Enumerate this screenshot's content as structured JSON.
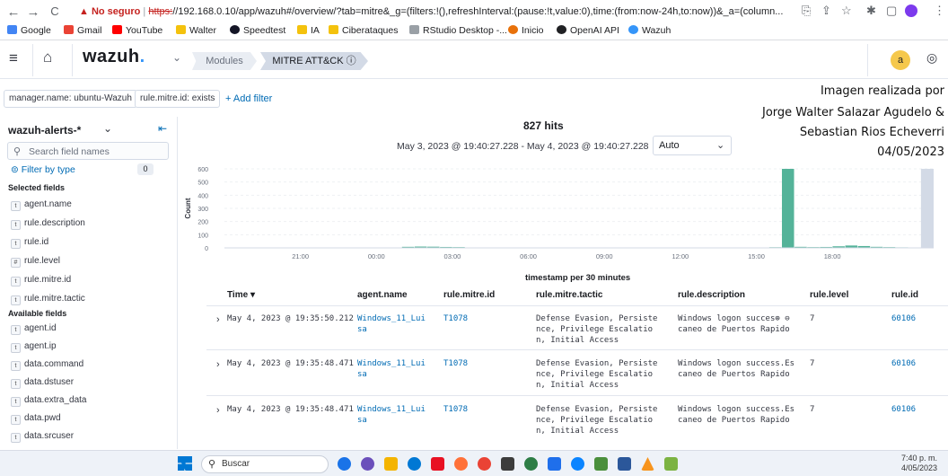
{
  "browser": {
    "nav": {
      "back": "←",
      "forward": "→",
      "reload": "C"
    },
    "warning": "▲ No seguro",
    "url_scheme": "https:",
    "url_rest": "//192.168.0.10/app/wazuh#/overview/?tab=mitre&_g=(filters:!(),refreshInterval:(pause:!t,value:0),time:(from:now-24h,to:now))&_a=(column...",
    "bookmarks": [
      {
        "label": "Google",
        "color": "#4285f4"
      },
      {
        "label": "Gmail",
        "color": "#ea4335"
      },
      {
        "label": "YouTube",
        "color": "#ff0000"
      },
      {
        "label": "Walter",
        "color": "#f4c20d"
      },
      {
        "label": "Speedtest",
        "color": "#141526"
      },
      {
        "label": "IA",
        "color": "#f4c20d"
      },
      {
        "label": "Ciberataques",
        "color": "#f4c20d"
      },
      {
        "label": "RStudio Desktop -...",
        "color": "#9aa0a6"
      },
      {
        "label": "Inicio",
        "color": "#e8710a"
      },
      {
        "label": "OpenAI API",
        "color": "#202124"
      },
      {
        "label": "Wazuh",
        "color": "#3595f9"
      }
    ]
  },
  "app": {
    "logo": "wazuh",
    "logo_dot": ".",
    "breadcrumb": {
      "modules": "Modules",
      "current": "MITRE ATT&CK ⓘ"
    },
    "user_initial": "a"
  },
  "filters": {
    "pills": [
      "manager.name: ubuntu-Wazuh",
      "rule.mitre.id: exists"
    ],
    "add_filter": "+ Add filter"
  },
  "sidebar": {
    "index_pattern": "wazuh-alerts-*",
    "search_placeholder": "Search field names",
    "filter_by_type": "Filter by type",
    "filter_count": "0",
    "selected_heading": "Selected fields",
    "selected": [
      {
        "type": "t",
        "name": "agent.name"
      },
      {
        "type": "t",
        "name": "rule.description"
      },
      {
        "type": "t",
        "name": "rule.id"
      },
      {
        "type": "#",
        "name": "rule.level"
      },
      {
        "type": "t",
        "name": "rule.mitre.id"
      },
      {
        "type": "t",
        "name": "rule.mitre.tactic"
      }
    ],
    "available_heading": "Available fields",
    "available": [
      {
        "type": "t",
        "name": "agent.id"
      },
      {
        "type": "t",
        "name": "agent.ip"
      },
      {
        "type": "t",
        "name": "data.command"
      },
      {
        "type": "t",
        "name": "data.dstuser"
      },
      {
        "type": "t",
        "name": "data.extra_data"
      },
      {
        "type": "t",
        "name": "data.pwd"
      },
      {
        "type": "t",
        "name": "data.srcuser"
      }
    ]
  },
  "main": {
    "hits": "827 hits",
    "range": "May 3, 2023 @ 19:40:27.228 - May 4, 2023 @ 19:40:27.228",
    "interval": "Auto",
    "x_title": "timestamp per 30 minutes"
  },
  "chart_data": {
    "type": "bar",
    "ylabel": "Count",
    "xlabel": "timestamp per 30 minutes",
    "ylim": [
      0,
      600
    ],
    "yticks": [
      0,
      100,
      200,
      300,
      400,
      500,
      600
    ],
    "xticks": [
      "21:00",
      "00:00",
      "03:00",
      "06:00",
      "09:00",
      "12:00",
      "15:00",
      "18:00"
    ],
    "bar_color": "#54b399",
    "bars": [
      {
        "slot": 14,
        "value": 8
      },
      {
        "slot": 15,
        "value": 10
      },
      {
        "slot": 16,
        "value": 9
      },
      {
        "slot": 17,
        "value": 7
      },
      {
        "slot": 18,
        "value": 6
      },
      {
        "slot": 42,
        "value": 3
      },
      {
        "slot": 43,
        "value": 5
      },
      {
        "slot": 44,
        "value": 600
      },
      {
        "slot": 45,
        "value": 8
      },
      {
        "slot": 46,
        "value": 6
      },
      {
        "slot": 47,
        "value": 7
      },
      {
        "slot": 48,
        "value": 12
      },
      {
        "slot": 49,
        "value": 18
      },
      {
        "slot": 50,
        "value": 14
      },
      {
        "slot": 51,
        "value": 8
      },
      {
        "slot": 52,
        "value": 6
      },
      {
        "slot": 53,
        "value": 4
      },
      {
        "slot": 54,
        "value": 3
      }
    ],
    "total_slots": 56
  },
  "table": {
    "headers": [
      "Time ▾",
      "agent.name",
      "rule.mitre.id",
      "rule.mitre.tactic",
      "rule.description",
      "rule.level",
      "rule.id"
    ],
    "rows": [
      {
        "time": "May 4, 2023 @ 19:35:50.212",
        "agent": "Windows_11_Lui\nsa",
        "mitre_id": "T1078",
        "tactic": "Defense Evasion, Persiste\nnce, Privilege Escalatio\nn, Initial Access",
        "description": "Windows logon succes⊕ ⊖\ncaneo de Puertos Rapido",
        "level": "7",
        "rule_id": "60106"
      },
      {
        "time": "May 4, 2023 @ 19:35:48.471",
        "agent": "Windows_11_Lui\nsa",
        "mitre_id": "T1078",
        "tactic": "Defense Evasion, Persiste\nnce, Privilege Escalatio\nn, Initial Access",
        "description": "Windows logon success.Es\ncaneo de Puertos Rapido",
        "level": "7",
        "rule_id": "60106"
      },
      {
        "time": "May 4, 2023 @ 19:35:48.471",
        "agent": "Windows_11_Lui\nsa",
        "mitre_id": "T1078",
        "tactic": "Defense Evasion, Persiste\nnce, Privilege Escalatio\nn, Initial Access",
        "description": "Windows logon success.Es\ncaneo de Puertos Rapido",
        "level": "7",
        "rule_id": "60106"
      }
    ]
  },
  "annotation": {
    "line1": "Imagen realizada por",
    "line2": "Jorge Walter Salazar Agudelo &",
    "line3": "Sebastian Rios Echeverri",
    "line4": "04/05/2023"
  },
  "taskbar": {
    "search": "Buscar",
    "time": "7:40 p. m.",
    "date": "4/05/2023",
    "apps": [
      "#1a73e8",
      "#6b4fbb",
      "#f4b400",
      "#0078d4",
      "#e81123",
      "#ff7139",
      "#ea4335",
      "#3c3c3c",
      "#2d7d46",
      "#1f6feb",
      "#0a84ff",
      "#4a8f3c",
      "#2b579a",
      "#f7941d",
      "#7cb342"
    ]
  }
}
